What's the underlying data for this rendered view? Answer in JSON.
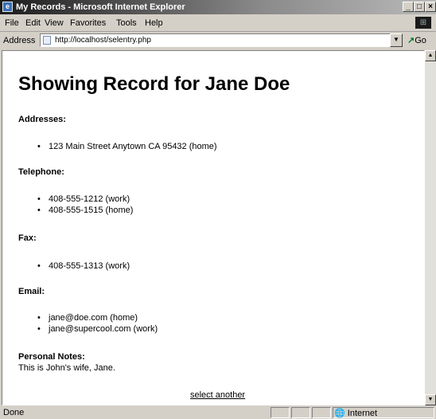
{
  "window": {
    "title": "My Records - Microsoft Internet Explorer"
  },
  "menu": [
    "File",
    "Edit",
    "View",
    "Favorites",
    "Tools",
    "Help"
  ],
  "address": {
    "label": "Address",
    "url": "http://localhost/selentry.php",
    "go_label": "Go"
  },
  "page": {
    "heading": "Showing Record for Jane Doe",
    "sections": [
      {
        "label": "Addresses:",
        "items": [
          "123 Main Street Anytown CA 95432 (home)"
        ]
      },
      {
        "label": "Telephone:",
        "items": [
          "408-555-1212 (work)",
          "408-555-1515 (home)"
        ]
      },
      {
        "label": "Fax:",
        "items": [
          "408-555-1313 (work)"
        ]
      },
      {
        "label": "Email:",
        "items": [
          "jane@doe.com (home)",
          "jane@supercool.com (work)"
        ]
      }
    ],
    "notes_label": "Personal Notes:",
    "notes_text": "This is John's wife, Jane.",
    "link_text": "select another"
  },
  "status": {
    "text": "Done",
    "zone": "Internet"
  }
}
